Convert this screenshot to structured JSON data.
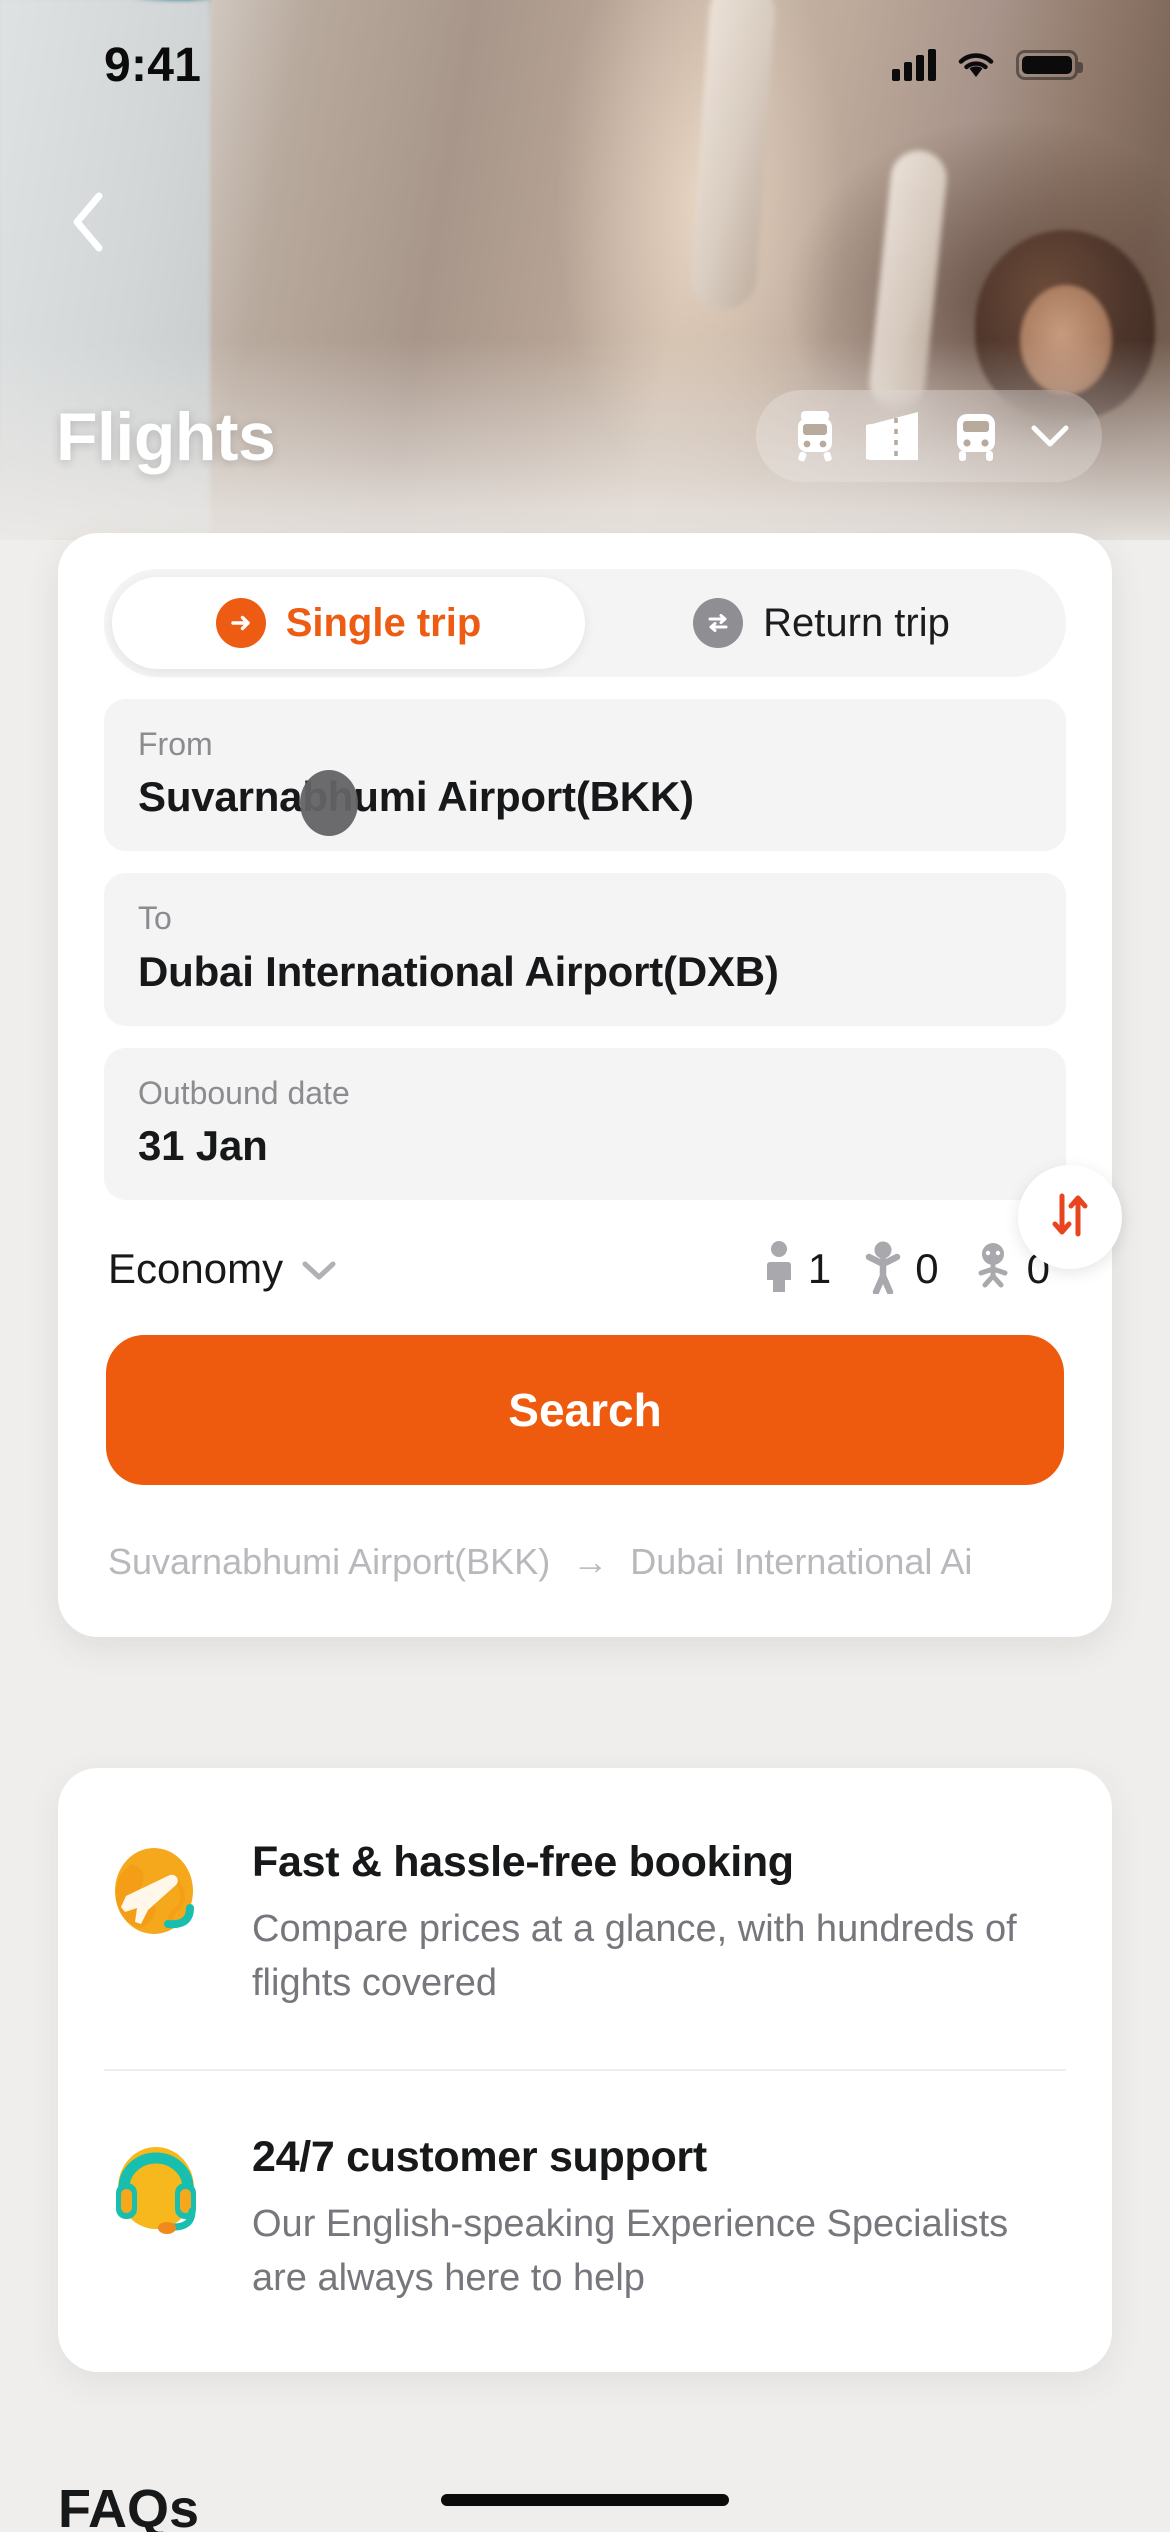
{
  "status_bar": {
    "time": "9:41",
    "signal_icon": "cellular-signal-icon",
    "wifi_icon": "wifi-icon",
    "battery_icon": "battery-full-icon"
  },
  "header": {
    "back_icon": "back-chevron-icon",
    "title": "Flights",
    "mode_switcher": {
      "icons": [
        "train-icon",
        "ticket-icon",
        "bus-icon"
      ],
      "chevron": "chevron-down-icon"
    }
  },
  "search_card": {
    "tabs": [
      {
        "label": "Single trip",
        "icon": "arrow-right-circle-icon",
        "active": true
      },
      {
        "label": "Return trip",
        "icon": "swap-horizontal-circle-icon",
        "active": false
      }
    ],
    "from": {
      "label": "From",
      "value": "Suvarnabhumi Airport(BKK)"
    },
    "to": {
      "label": "To",
      "value": "Dubai International Airport(DXB)"
    },
    "swap_icon": "swap-vertical-icon",
    "date": {
      "label": "Outbound date",
      "value": "31 Jan"
    },
    "cabin_class": {
      "value": "Economy",
      "chevron": "chevron-down-icon"
    },
    "passengers": [
      {
        "type": "adult",
        "icon": "adult-icon",
        "count": "1"
      },
      {
        "type": "child",
        "icon": "child-icon",
        "count": "0"
      },
      {
        "type": "infant",
        "icon": "infant-icon",
        "count": "0"
      }
    ],
    "search_button": "Search",
    "route_summary": {
      "origin": "Suvarnabhumi Airport(BKK)",
      "arrow": "→",
      "destination": "Dubai International Ai"
    }
  },
  "features": [
    {
      "icon": "globe-plane-icon",
      "title": "Fast & hassle-free booking",
      "description": "Compare prices at a glance, with hundreds of flights covered"
    },
    {
      "icon": "headset-support-icon",
      "title": "24/7 customer support",
      "description": "Our English-speaking Experience Specialists are always here to help"
    }
  ],
  "faqs_heading": "FAQs",
  "colors": {
    "accent": "#ee5a0e",
    "tab_active_text": "#ee5c14",
    "muted": "#8b8b90",
    "field_bg": "#f4f4f5"
  }
}
